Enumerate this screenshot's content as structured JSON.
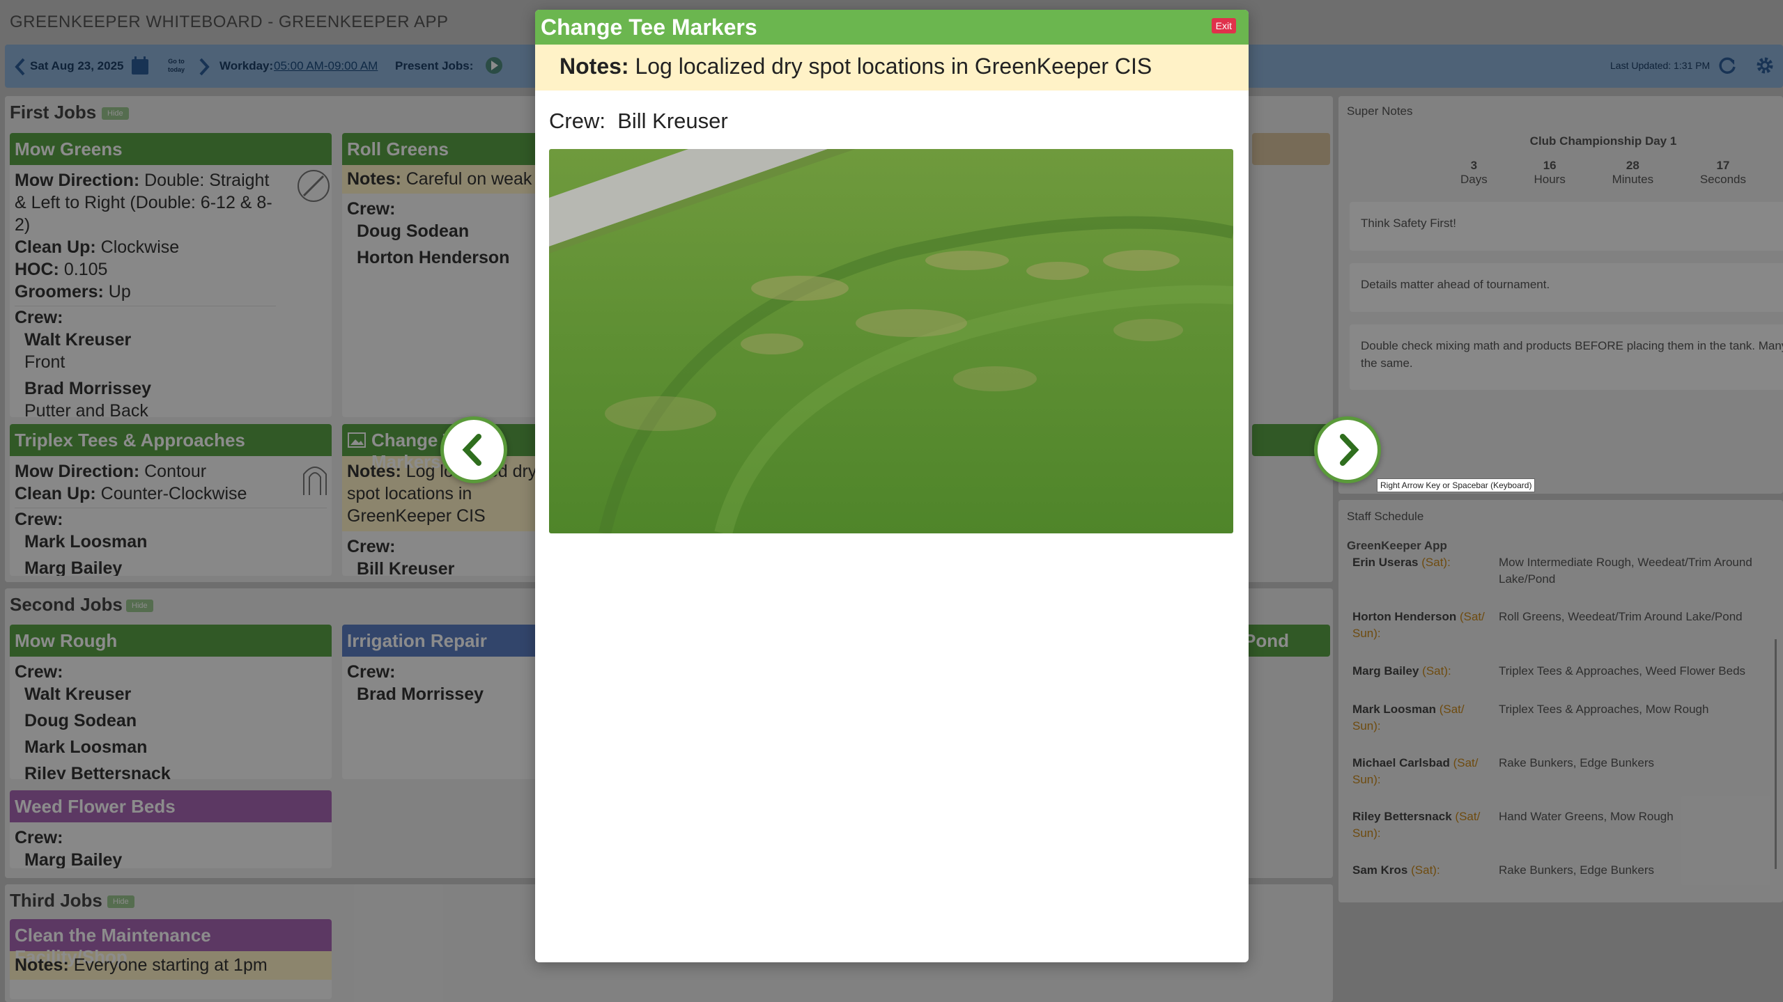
{
  "app_title": "GREENKEEPER WHITEBOARD - GREENKEEPER APP",
  "toolbar": {
    "date": "Sat Aug 23, 2025",
    "goto_today": "Go to today",
    "workday_label": "Workday:",
    "workday_value": "05:00 AM-09:00 AM",
    "present_jobs_label": "Present Jobs:",
    "last_updated": "Last Updated: 1:31 PM"
  },
  "first_jobs": {
    "title": "First Jobs",
    "hide": "Hide",
    "mow_greens": {
      "title": "Mow Greens",
      "direction_label": "Mow Direction:",
      "direction_value": "Double: Straight & Left to Right (Double: 6-12 & 8-2)",
      "cleanup_label": "Clean Up:",
      "cleanup_value": "Clockwise",
      "hoc_label": "HOC:",
      "hoc_value": "0.105",
      "groomers_label": "Groomers:",
      "groomers_value": "Up",
      "crew_label": "Crew:",
      "crew": [
        {
          "name": "Walt Kreuser",
          "note": "Front"
        },
        {
          "name": "Brad Morrissey",
          "note": "Putter and Back"
        }
      ]
    },
    "roll_greens": {
      "title": "Roll Greens",
      "notes_label": "Notes:",
      "notes_value": "Careful on weak",
      "crew_label": "Crew:",
      "crew": [
        "Doug Sodean",
        "Horton Henderson"
      ]
    },
    "triplex": {
      "title": "Triplex Tees & Approaches",
      "direction_label": "Mow Direction:",
      "direction_value": "Contour",
      "cleanup_label": "Clean Up:",
      "cleanup_value": "Counter-Clockwise",
      "crew_label": "Crew:",
      "crew": [
        "Mark Loosman",
        "Marg Bailey"
      ]
    },
    "change_tee": {
      "title": "Change Tee Markers",
      "notes_label": "Notes:",
      "notes_value": "Log localized dry spot locations in GreenKeeper CIS",
      "crew_label": "Crew:",
      "crew": [
        "Bill Kreuser"
      ]
    }
  },
  "second_jobs": {
    "title": "Second Jobs",
    "hide": "Hide",
    "mow_rough": {
      "title": "Mow Rough",
      "crew_label": "Crew:",
      "crew": [
        "Walt Kreuser",
        "Doug Sodean",
        "Mark Loosman",
        "Riley Bettersnack"
      ]
    },
    "irrigation": {
      "title": "Irrigation Repair",
      "crew_label": "Crew:",
      "crew": [
        "Brad Morrissey"
      ]
    },
    "pond_fragment": "Pond",
    "weed_flower": {
      "title": "Weed Flower Beds",
      "crew_label": "Crew:",
      "crew": [
        "Marg Bailey"
      ]
    }
  },
  "third_jobs": {
    "title": "Third Jobs",
    "hide": "Hide",
    "clean_facility": {
      "title": "Clean the Maintenance Facility/Shop",
      "notes_label": "Notes:",
      "notes_value": "Everyone starting at 1pm"
    }
  },
  "super_notes": {
    "title": "Super Notes",
    "countdown_title": "Club Championship Day 1",
    "countdown": [
      {
        "value": "3",
        "unit": "Days"
      },
      {
        "value": "16",
        "unit": "Hours"
      },
      {
        "value": "28",
        "unit": "Minutes"
      },
      {
        "value": "17",
        "unit": "Seconds"
      }
    ],
    "notes": [
      "Think Safety First!",
      "Details matter ahead of tournament.",
      "Double check mixing math and products BEFORE placing them in the tank. Many look the same."
    ]
  },
  "staff_schedule": {
    "title": "Staff Schedule",
    "subtitle": "GreenKeeper App",
    "rows": [
      {
        "name": "Erin Useras",
        "days": "(Sat):",
        "jobs": "Mow Intermediate Rough, Weedeat/Trim Around Lake/Pond"
      },
      {
        "name": "Horton Henderson",
        "days": "(Sat/ Sun):",
        "jobs": "Roll Greens, Weedeat/Trim Around Lake/Pond"
      },
      {
        "name": "Marg Bailey",
        "days": "(Sat):",
        "jobs": "Triplex Tees & Approaches, Weed Flower Beds"
      },
      {
        "name": "Mark Loosman",
        "days": "(Sat/ Sun):",
        "jobs": "Triplex Tees & Approaches, Mow Rough"
      },
      {
        "name": "Michael Carlsbad",
        "days": "(Sat/ Sun):",
        "jobs": "Rake Bunkers, Edge Bunkers"
      },
      {
        "name": "Riley Bettersnack",
        "days": "(Sat/ Sun):",
        "jobs": "Hand Water Greens, Mow Rough"
      },
      {
        "name": "Sam Kros",
        "days": "(Sat):",
        "jobs": "Rake Bunkers, Edge Bunkers"
      }
    ]
  },
  "modal": {
    "title": "Change Tee Markers",
    "exit": "Exit",
    "notes_label": "Notes:",
    "notes_value": "Log localized dry spot locations in GreenKeeper CIS",
    "crew_label": "Crew:",
    "crew_value": "Bill Kreuser",
    "tooltip": "Right Arrow Key or Spacebar (Keyboard)"
  },
  "colors": {
    "green_header": "#5aa346",
    "blue_header": "#5b7fc4",
    "purple_header": "#a866b5",
    "notes_bg": "#fff2c7",
    "toolbar_bg": "#8fb3d9"
  }
}
